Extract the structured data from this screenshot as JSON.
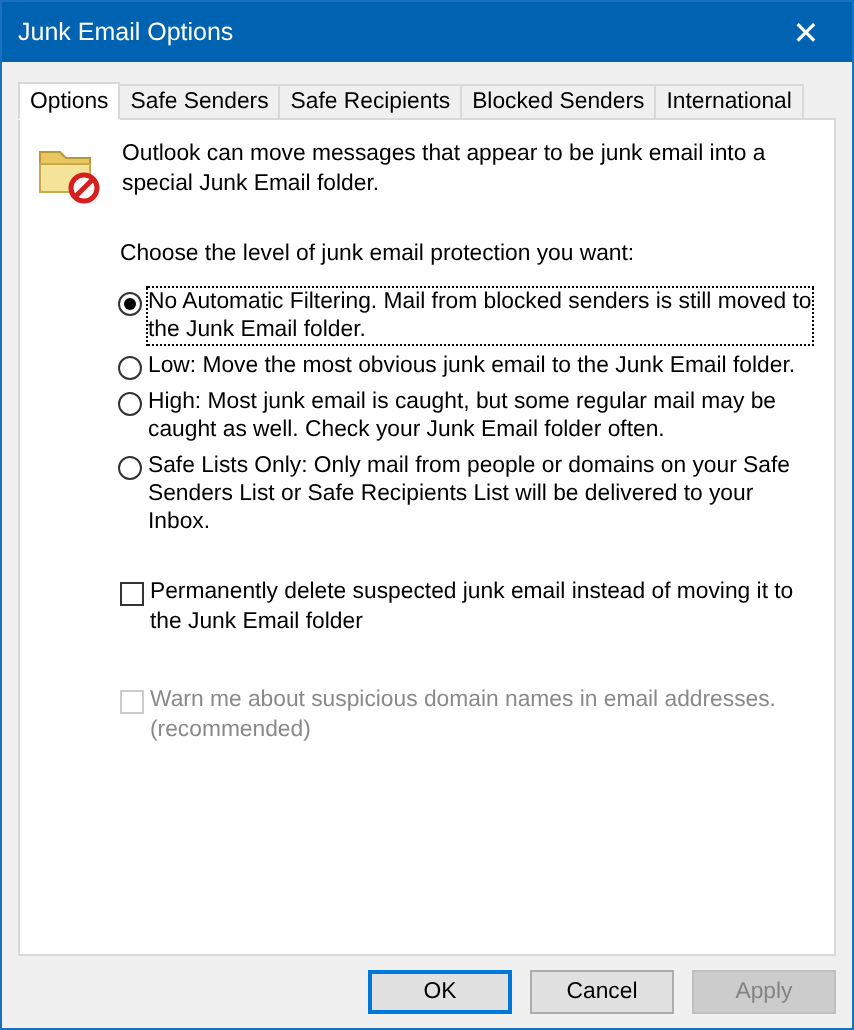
{
  "window": {
    "title": "Junk Email Options",
    "close": "✕"
  },
  "tabs": [
    {
      "label": "Options",
      "selected": true
    },
    {
      "label": "Safe Senders",
      "selected": false
    },
    {
      "label": "Safe Recipients",
      "selected": false
    },
    {
      "label": "Blocked Senders",
      "selected": false
    },
    {
      "label": "International",
      "selected": false
    }
  ],
  "intro": "Outlook can move messages that appear to be junk email into a special Junk Email folder.",
  "prompt": "Choose the level of junk email protection you want:",
  "levels": [
    {
      "label": "No Automatic Filtering. Mail from blocked senders is still moved to the Junk Email folder.",
      "selected": true,
      "focused": true
    },
    {
      "label": "Low: Move the most obvious junk email to the Junk Email folder.",
      "selected": false,
      "focused": false
    },
    {
      "label": "High: Most junk email is caught, but some regular mail may be caught as well. Check your Junk Email folder often.",
      "selected": false,
      "focused": false
    },
    {
      "label": "Safe Lists Only: Only mail from people or domains on your Safe Senders List or Safe Recipients List will be delivered to your Inbox.",
      "selected": false,
      "focused": false
    }
  ],
  "checkboxes": [
    {
      "label": "Permanently delete suspected junk email instead of moving it to the Junk Email folder",
      "checked": false,
      "disabled": false
    },
    {
      "label": "Warn me about suspicious domain names in email addresses. (recommended)",
      "checked": false,
      "disabled": true
    }
  ],
  "buttons": [
    {
      "label": "OK",
      "default": true,
      "disabled": false
    },
    {
      "label": "Cancel",
      "default": false,
      "disabled": false
    },
    {
      "label": "Apply",
      "default": false,
      "disabled": true
    }
  ]
}
